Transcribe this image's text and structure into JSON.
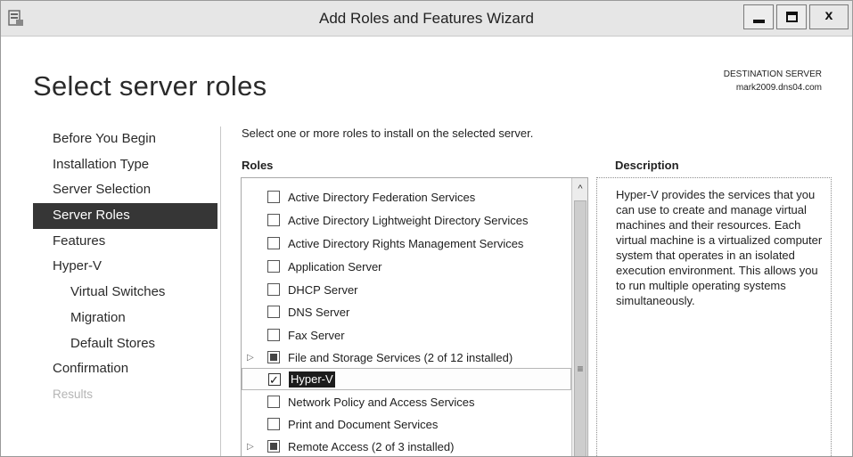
{
  "window": {
    "title": "Add Roles and Features Wizard",
    "close_glyph": "x",
    "colors": {
      "titlebar": "#e6e6e6",
      "nav_active": "#363636"
    }
  },
  "header": {
    "page_title": "Select server roles",
    "destination_label": "DESTINATION SERVER",
    "destination_server": "mark2009.dns04.com"
  },
  "nav": {
    "items": [
      {
        "label": "Before You Begin",
        "state": "normal"
      },
      {
        "label": "Installation Type",
        "state": "normal"
      },
      {
        "label": "Server Selection",
        "state": "normal"
      },
      {
        "label": "Server Roles",
        "state": "active"
      },
      {
        "label": "Features",
        "state": "normal"
      },
      {
        "label": "Hyper-V",
        "state": "normal"
      },
      {
        "label": "Virtual Switches",
        "state": "sub"
      },
      {
        "label": "Migration",
        "state": "sub"
      },
      {
        "label": "Default Stores",
        "state": "sub"
      },
      {
        "label": "Confirmation",
        "state": "normal"
      },
      {
        "label": "Results",
        "state": "disabled"
      }
    ]
  },
  "main": {
    "instruction": "Select one or more roles to install on the selected server.",
    "roles_header": "Roles",
    "description_header": "Description",
    "description_text": "Hyper-V provides the services that you can use to create and manage virtual machines and their resources. Each virtual machine is a virtualized computer system that operates in an isolated execution environment. This allows you to run multiple operating systems simultaneously.",
    "roles": [
      {
        "label": "Active Directory Federation Services",
        "state": "unchecked",
        "expandable": false
      },
      {
        "label": "Active Directory Lightweight Directory Services",
        "state": "unchecked",
        "expandable": false
      },
      {
        "label": "Active Directory Rights Management Services",
        "state": "unchecked",
        "expandable": false
      },
      {
        "label": "Application Server",
        "state": "unchecked",
        "expandable": false
      },
      {
        "label": "DHCP Server",
        "state": "unchecked",
        "expandable": false
      },
      {
        "label": "DNS Server",
        "state": "unchecked",
        "expandable": false
      },
      {
        "label": "Fax Server",
        "state": "unchecked",
        "expandable": false
      },
      {
        "label": "File and Storage Services (2 of 12 installed)",
        "state": "partial",
        "expandable": true
      },
      {
        "label": "Hyper-V",
        "state": "checked",
        "expandable": false,
        "selected": true
      },
      {
        "label": "Network Policy and Access Services",
        "state": "unchecked",
        "expandable": false
      },
      {
        "label": "Print and Document Services",
        "state": "unchecked",
        "expandable": false
      },
      {
        "label": "Remote Access (2 of 3 installed)",
        "state": "partial",
        "expandable": true
      }
    ]
  },
  "icons": {
    "app": "wizard-app-icon",
    "expander": "▷",
    "scroll_up": "^",
    "scroll_grip": "≡"
  }
}
